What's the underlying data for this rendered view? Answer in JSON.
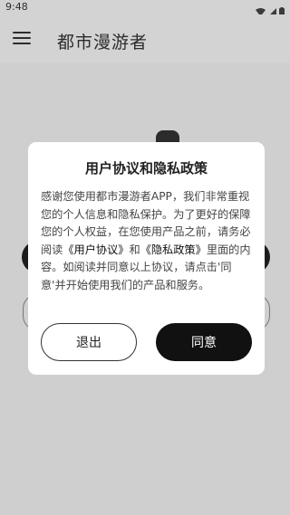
{
  "status_bar": {
    "time": "9:48",
    "icons": [
      "wifi-icon",
      "signal-icon",
      "battery-icon"
    ]
  },
  "app_bar": {
    "title": "都市漫游者",
    "menu_icon": "menu-icon"
  },
  "dialog": {
    "title": "用户协议和隐私政策",
    "body_intro": "感谢您使用都市漫游者APP，我们非常重视您的个人信息和隐私保护。为了更好的保障您的个人权益，在您使用产品之前，请务必阅读",
    "link_user_agreement": "《用户协议》",
    "and": "和",
    "link_privacy_policy": "《隐私政策》",
    "body_outro": "里面的内容。如阅读并同意以上协议，请点击'同意'并开始使用我们的产品和服务。",
    "exit_label": "退出",
    "agree_label": "同意"
  },
  "colors": {
    "primary": "#111111",
    "dialog_bg": "#ffffff",
    "background": "#ececec"
  }
}
